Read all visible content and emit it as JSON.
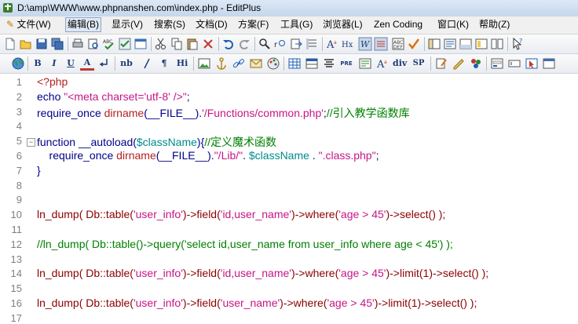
{
  "window": {
    "title": "D:\\amp\\WWW\\www.phpnanshen.com\\index.php - EditPlus"
  },
  "menubar": {
    "items": [
      {
        "label": "文件(W)"
      },
      {
        "label": "编辑(B)",
        "active": true
      },
      {
        "label": "显示(V)"
      },
      {
        "label": "搜索(S)"
      },
      {
        "label": "文档(D)"
      },
      {
        "label": "方案(F)"
      },
      {
        "label": "工具(G)"
      },
      {
        "label": "浏览器(L)"
      },
      {
        "label": "Zen Coding"
      },
      {
        "label": "窗口(K)"
      },
      {
        "label": "帮助(Z)"
      }
    ]
  },
  "toolbar2": {
    "bold": "B",
    "italic": "I",
    "underline": "U",
    "fontcolor": "A",
    "nbsp": "nb",
    "paragraph": "¶",
    "heading": "Hi",
    "pre": "PRE",
    "div": "div",
    "span": "SP"
  },
  "colors": {
    "keyword": "#00008b",
    "string": "#c71585",
    "function": "#b22222",
    "variable": "#008b8b",
    "comment": "#008000",
    "call": "#8b0000"
  },
  "editor": {
    "lines": [
      {
        "num": "1",
        "tokens": [
          {
            "t": "<?php",
            "c": "c-tag"
          }
        ]
      },
      {
        "num": "2",
        "tokens": [
          {
            "t": "echo ",
            "c": "c-kw"
          },
          {
            "t": "\"<meta charset='utf-8' />\"",
            "c": "c-str"
          },
          {
            "t": ";",
            "c": "c-kw"
          }
        ]
      },
      {
        "num": "3",
        "tokens": [
          {
            "t": "require_once ",
            "c": "c-kw"
          },
          {
            "t": "dirname",
            "c": "c-fn"
          },
          {
            "t": "(__FILE__).",
            "c": "c-kw"
          },
          {
            "t": "'/Functions/common.php'",
            "c": "c-str"
          },
          {
            "t": ";",
            "c": "c-kw"
          },
          {
            "t": "//引入教学函数库",
            "c": "c-com"
          }
        ]
      },
      {
        "num": "4",
        "tokens": []
      },
      {
        "num": "5",
        "fold": true,
        "tokens": [
          {
            "t": "function ",
            "c": "c-kw"
          },
          {
            "t": "__autoload(",
            "c": "c-kw"
          },
          {
            "t": "$className",
            "c": "c-var"
          },
          {
            "t": "){",
            "c": "c-kw"
          },
          {
            "t": "//定义魔术函数",
            "c": "c-com"
          }
        ]
      },
      {
        "num": "6",
        "tokens": [
          {
            "t": "    require_once ",
            "c": "c-kw"
          },
          {
            "t": "dirname",
            "c": "c-fn"
          },
          {
            "t": "(__FILE__).",
            "c": "c-kw"
          },
          {
            "t": "\"/Lib/\"",
            "c": "c-str"
          },
          {
            "t": ". ",
            "c": "c-kw"
          },
          {
            "t": "$className",
            "c": "c-var"
          },
          {
            "t": " . ",
            "c": "c-kw"
          },
          {
            "t": "\".class.php\"",
            "c": "c-str"
          },
          {
            "t": ";",
            "c": "c-kw"
          }
        ]
      },
      {
        "num": "7",
        "tokens": [
          {
            "t": "}",
            "c": "c-kw"
          }
        ]
      },
      {
        "num": "8",
        "tokens": []
      },
      {
        "num": "9",
        "tokens": []
      },
      {
        "num": "10",
        "tokens": [
          {
            "t": "ln_dump( Db::table(",
            "c": "c-plain"
          },
          {
            "t": "'user_info'",
            "c": "c-str"
          },
          {
            "t": ")->field(",
            "c": "c-plain"
          },
          {
            "t": "'id,user_name'",
            "c": "c-str"
          },
          {
            "t": ")->where(",
            "c": "c-plain"
          },
          {
            "t": "'age > 45'",
            "c": "c-str"
          },
          {
            "t": ")->select() );",
            "c": "c-plain"
          }
        ]
      },
      {
        "num": "11",
        "tokens": []
      },
      {
        "num": "12",
        "tokens": [
          {
            "t": "//ln_dump( Db::table()->query('select id,user_name from user_info where age < 45') );",
            "c": "c-com"
          }
        ]
      },
      {
        "num": "13",
        "tokens": []
      },
      {
        "num": "14",
        "tokens": [
          {
            "t": "ln_dump( Db::table(",
            "c": "c-plain"
          },
          {
            "t": "'user_info'",
            "c": "c-str"
          },
          {
            "t": ")->field(",
            "c": "c-plain"
          },
          {
            "t": "'id,user_name'",
            "c": "c-str"
          },
          {
            "t": ")->where(",
            "c": "c-plain"
          },
          {
            "t": "'age > 45'",
            "c": "c-str"
          },
          {
            "t": ")->limit(1)->select() );",
            "c": "c-plain"
          }
        ]
      },
      {
        "num": "15",
        "tokens": []
      },
      {
        "num": "16",
        "tokens": [
          {
            "t": "ln_dump( Db::table(",
            "c": "c-plain"
          },
          {
            "t": "'user_info'",
            "c": "c-str"
          },
          {
            "t": ")->field(",
            "c": "c-plain"
          },
          {
            "t": "'user_name'",
            "c": "c-str"
          },
          {
            "t": ")->where(",
            "c": "c-plain"
          },
          {
            "t": "'age > 45'",
            "c": "c-str"
          },
          {
            "t": ")->limit(1)->select() );",
            "c": "c-plain"
          }
        ]
      },
      {
        "num": "17",
        "tokens": []
      }
    ]
  }
}
